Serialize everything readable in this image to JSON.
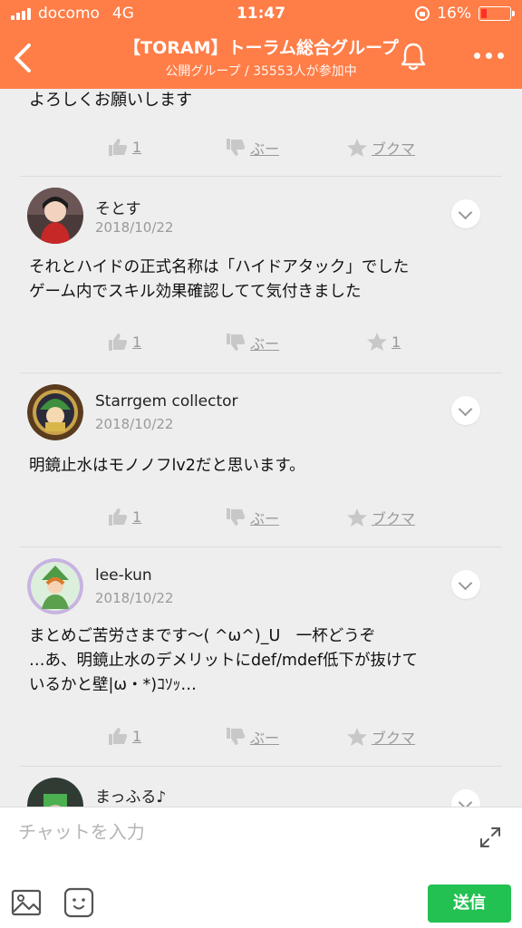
{
  "status_bar": {
    "carrier": "docomo",
    "network": "4G",
    "time": "11:47",
    "battery": "16%"
  },
  "header": {
    "title": "【TORAM】トーラム総合グループ",
    "subtitle": "公開グループ / 35553人が参加中",
    "bg_color": "#ff7d47"
  },
  "feed": {
    "top_text": "よろしくお願いします",
    "top_actions": {
      "like": "1",
      "dislike": "ぶー",
      "bookmark": "ブクマ"
    },
    "posts": [
      {
        "name": "そとす",
        "date": "2018/10/22",
        "text": "それとハイドの正式名称は「ハイドアタック」でした\nゲーム内でスキル効果確認してて気付きました",
        "like": "1",
        "dislike": "ぶー",
        "bookmark": "1"
      },
      {
        "name": "Starrgem collector",
        "date": "2018/10/22",
        "text": "明鏡止水はモノノフlv2だと思います。",
        "like": "1",
        "dislike": "ぶー",
        "bookmark": "ブクマ"
      },
      {
        "name": "lee-kun",
        "date": "2018/10/22",
        "text": "まとめご苦労さまです〜( ^ω^)_U　一杯どうぞ\n…あ、明鏡止水のデメリットにdef/mdef低下が抜けて\nいるかと壁|ω・*)ｺｿｯ…",
        "like": "1",
        "dislike": "ぶー",
        "bookmark": "ブクマ"
      },
      {
        "name": "まっふる♪"
      }
    ]
  },
  "composer": {
    "placeholder": "チャットを入力",
    "send_label": "送信",
    "send_color": "#22c152"
  }
}
